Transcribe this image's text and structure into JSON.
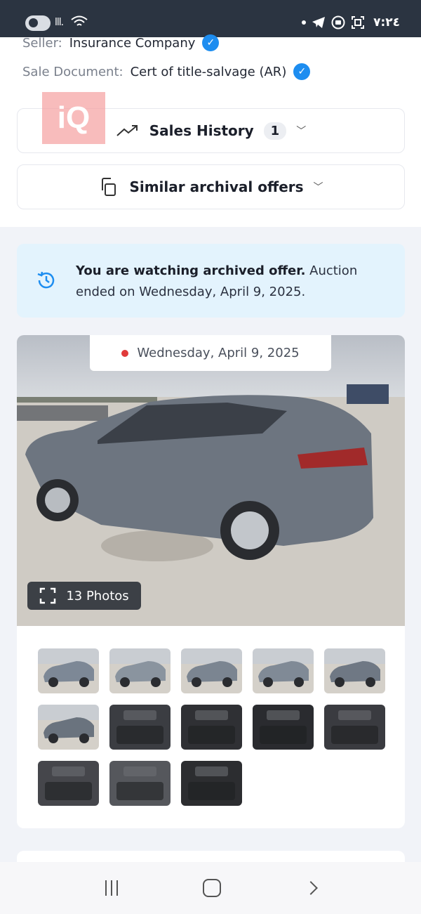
{
  "status_bar": {
    "time": "٧:٢٤",
    "signal_text": "lll.",
    "icons": [
      "toggle-icon",
      "signal-icon",
      "wifi-icon",
      "dot-icon",
      "telegram-icon",
      "media-icon",
      "screenshot-icon"
    ]
  },
  "details": {
    "seller_label": "Seller:",
    "seller_value": "Insurance Company",
    "sale_doc_label": "Sale Document:",
    "sale_doc_value": "Cert of title-salvage (AR)"
  },
  "watermark": "iQ",
  "sales_history": {
    "label": "Sales History",
    "count": "1"
  },
  "similar_offers": {
    "label": "Similar archival offers"
  },
  "notice": {
    "bold": "You are watching archived offer.",
    "text": " Auction ended on Wednesday, April 9, 2025."
  },
  "gallery": {
    "date": "Wednesday, April 9, 2025",
    "photos_label": "13 Photos",
    "thumbnails": [
      {
        "subject": "front-left exterior",
        "color": "#7d8896"
      },
      {
        "subject": "left side exterior",
        "color": "#8a949f"
      },
      {
        "subject": "rear-left exterior",
        "color": "#7b8591"
      },
      {
        "subject": "front-right exterior",
        "color": "#808a96"
      },
      {
        "subject": "front exterior",
        "color": "#6f7884"
      },
      {
        "subject": "rear exterior",
        "color": "#6a737e"
      },
      {
        "subject": "front seat interior",
        "color": "#3b3d42"
      },
      {
        "subject": "dashboard interior",
        "color": "#2f3034"
      },
      {
        "subject": "instrument cluster",
        "color": "#2a2b2f"
      },
      {
        "subject": "rear seats",
        "color": "#3a3b40"
      },
      {
        "subject": "rear seat door",
        "color": "#45464b"
      },
      {
        "subject": "engine bay",
        "color": "#55575c"
      },
      {
        "subject": "vin label",
        "color": "#2c2d30"
      }
    ]
  },
  "colors": {
    "accent_blue": "#1d8df0",
    "notice_bg": "#e3f3fd",
    "status_red": "#e03a3a"
  }
}
